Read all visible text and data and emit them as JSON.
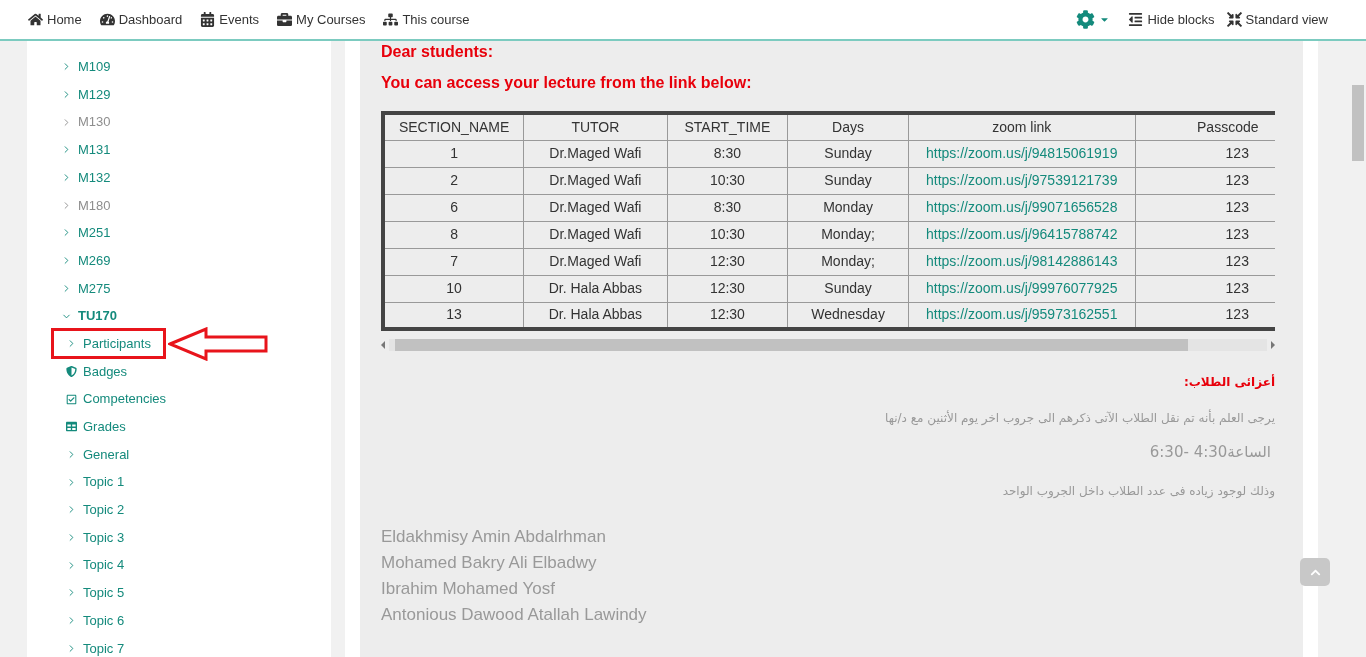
{
  "navbar": {
    "left": [
      {
        "kind": "home",
        "label": "Home"
      },
      {
        "kind": "dashboard",
        "label": "Dashboard"
      },
      {
        "kind": "calendar",
        "label": "Events"
      },
      {
        "kind": "briefcase",
        "label": "My Courses"
      },
      {
        "kind": "sitemap",
        "label": "This course"
      }
    ],
    "right": [
      {
        "kind": "hide",
        "label": "Hide blocks"
      },
      {
        "kind": "shrink",
        "label": "Standard view"
      }
    ]
  },
  "sidebar": {
    "items": [
      {
        "label": "M109",
        "expanded": false,
        "dimmed": false
      },
      {
        "label": "M129",
        "expanded": false,
        "dimmed": false
      },
      {
        "label": "M130",
        "expanded": false,
        "dimmed": true
      },
      {
        "label": "M131",
        "expanded": false,
        "dimmed": false
      },
      {
        "label": "M132",
        "expanded": false,
        "dimmed": false
      },
      {
        "label": "M180",
        "expanded": false,
        "dimmed": true
      },
      {
        "label": "M251",
        "expanded": false,
        "dimmed": false
      },
      {
        "label": "M269",
        "expanded": false,
        "dimmed": false
      },
      {
        "label": "M275",
        "expanded": false,
        "dimmed": false
      },
      {
        "label": "TU170",
        "expanded": true,
        "dimmed": false,
        "children": [
          {
            "kind": "chevron",
            "label": "Participants",
            "highlighted": true
          },
          {
            "kind": "shield",
            "label": "Badges",
            "highlighted": false
          },
          {
            "kind": "check",
            "label": "Competencies",
            "highlighted": false
          },
          {
            "kind": "table",
            "label": "Grades",
            "highlighted": false
          },
          {
            "kind": "chevron",
            "label": "General",
            "highlighted": false
          },
          {
            "kind": "chevron",
            "label": "Topic 1",
            "highlighted": false
          },
          {
            "kind": "chevron",
            "label": "Topic 2",
            "highlighted": false
          },
          {
            "kind": "chevron",
            "label": "Topic 3",
            "highlighted": false
          },
          {
            "kind": "chevron",
            "label": "Topic 4",
            "highlighted": false
          },
          {
            "kind": "chevron",
            "label": "Topic 5",
            "highlighted": false
          },
          {
            "kind": "chevron",
            "label": "Topic 6",
            "highlighted": false
          },
          {
            "kind": "chevron",
            "label": "Topic 7",
            "highlighted": false
          }
        ]
      }
    ]
  },
  "content": {
    "greeting": "Dear students:",
    "heading": "You can access your lecture from the link below:",
    "table": {
      "columns": [
        "SECTION_NAME",
        "TUTOR",
        "START_TIME",
        "Days",
        "zoom link",
        "Passcode"
      ],
      "rows": [
        [
          "1",
          "Dr.Maged Wafi",
          "8:30",
          "Sunday",
          "https://zoom.us/j/94815061919",
          "123"
        ],
        [
          "2",
          "Dr.Maged Wafi",
          "10:30",
          "Sunday",
          "https://zoom.us/j/97539121739",
          "123"
        ],
        [
          "6",
          "Dr.Maged Wafi",
          "8:30",
          "Monday",
          "https://zoom.us/j/99071656528",
          "123"
        ],
        [
          "8",
          "Dr.Maged Wafi",
          "10:30",
          "Monday;",
          "https://zoom.us/j/96415788742",
          "123"
        ],
        [
          "7",
          "Dr.Maged Wafi",
          "12:30",
          "Monday;",
          "https://zoom.us/j/98142886143",
          "123"
        ],
        [
          "10",
          "Dr. Hala Abbas",
          "12:30",
          "Sunday",
          "https://zoom.us/j/99976077925",
          "123"
        ],
        [
          "13",
          "Dr. Hala Abbas",
          "12:30",
          "Wednesday",
          "https://zoom.us/j/95973162551",
          "123"
        ]
      ]
    },
    "arabic_title": "أعزائى الطلاب:",
    "arabic_lines": [
      "يرجى العلم بأنه تم نقل الطلاب الآتى ذكرهم الى جروب اخر يوم الأثنين مع د/نها",
      "الساعة4:30 -6:30",
      "وذلك لوجود زياده فى عدد الطلاب داخل الجروب الواحد"
    ],
    "names": [
      "Eldakhmisy Amin Abdalrhman",
      "Mohamed Bakry Ali Elbadwy",
      "Ibrahim Mohamed Yosf",
      "Antonious Dawood Atallah Lawindy"
    ]
  }
}
